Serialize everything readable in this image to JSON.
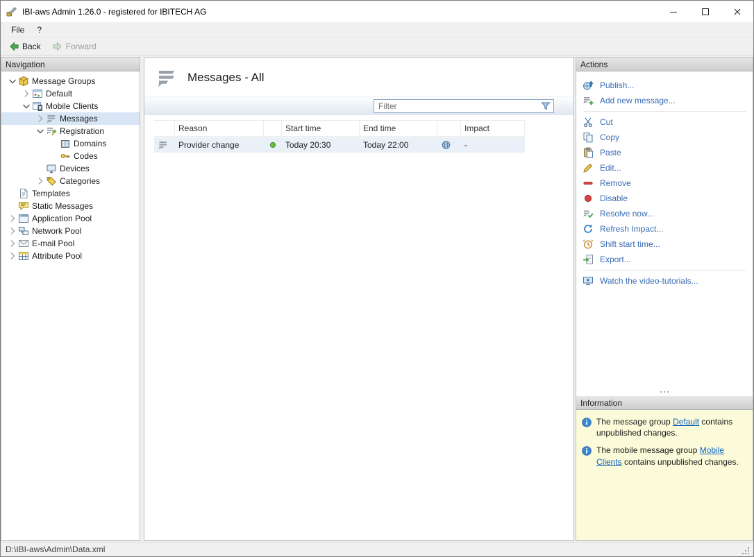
{
  "window": {
    "title": "IBI-aws Admin 1.26.0 - registered for IBITECH AG"
  },
  "menu": {
    "items": [
      "File",
      "?"
    ]
  },
  "toolbar": {
    "back": "Back",
    "forward": "Forward"
  },
  "navigation": {
    "header": "Navigation",
    "tree": [
      {
        "id": "message-groups",
        "label": "Message Groups",
        "level": 0,
        "icon": "message-groups",
        "expanded": true
      },
      {
        "id": "default",
        "label": "Default",
        "level": 1,
        "icon": "group-window",
        "collapsible": true
      },
      {
        "id": "mobile-clients",
        "label": "Mobile Clients",
        "level": 1,
        "icon": "mobile-window",
        "expanded": true
      },
      {
        "id": "messages",
        "label": "Messages",
        "level": 2,
        "icon": "messages",
        "collapsible": true,
        "selected": true
      },
      {
        "id": "registration",
        "label": "Registration",
        "level": 2,
        "icon": "registration",
        "expanded": true
      },
      {
        "id": "domains",
        "label": "Domains",
        "level": 3,
        "icon": "domains"
      },
      {
        "id": "codes",
        "label": "Codes",
        "level": 3,
        "icon": "codes"
      },
      {
        "id": "devices",
        "label": "Devices",
        "level": 2,
        "icon": "devices"
      },
      {
        "id": "categories",
        "label": "Categories",
        "level": 2,
        "icon": "categories",
        "collapsible": true
      },
      {
        "id": "templates",
        "label": "Templates",
        "level": 0,
        "icon": "templates"
      },
      {
        "id": "static-messages",
        "label": "Static Messages",
        "level": 0,
        "icon": "static-messages"
      },
      {
        "id": "application-pool",
        "label": "Application Pool",
        "level": 0,
        "icon": "application-pool",
        "collapsible": true
      },
      {
        "id": "network-pool",
        "label": "Network Pool",
        "level": 0,
        "icon": "network-pool",
        "collapsible": true
      },
      {
        "id": "e-mail-pool",
        "label": "E-mail Pool",
        "level": 0,
        "icon": "email-pool",
        "collapsible": true
      },
      {
        "id": "attribute-pool",
        "label": "Attribute Pool",
        "level": 0,
        "icon": "attribute-pool",
        "collapsible": true
      }
    ]
  },
  "main": {
    "title": "Messages - All",
    "filter": {
      "placeholder": "Filter"
    },
    "table": {
      "columns": [
        "",
        "Reason",
        "",
        "Start time",
        "End time",
        "",
        "Impact"
      ],
      "rows": [
        {
          "reason": "Provider change",
          "status": "active",
          "start": "Today 20:30",
          "end": "Today 22:00",
          "impact": "-"
        }
      ]
    }
  },
  "actions": {
    "header": "Actions",
    "items": [
      {
        "id": "publish",
        "label": "Publish...",
        "icon": "publish"
      },
      {
        "id": "add-new-message",
        "label": "Add new message...",
        "icon": "add-message",
        "divider_after": true
      },
      {
        "id": "cut",
        "label": "Cut",
        "icon": "cut"
      },
      {
        "id": "copy",
        "label": "Copy",
        "icon": "copy"
      },
      {
        "id": "paste",
        "label": "Paste",
        "icon": "paste"
      },
      {
        "id": "edit",
        "label": "Edit...",
        "icon": "edit"
      },
      {
        "id": "remove",
        "label": "Remove",
        "icon": "remove"
      },
      {
        "id": "disable",
        "label": "Disable",
        "icon": "disable"
      },
      {
        "id": "resolve-now",
        "label": "Resolve now...",
        "icon": "resolve"
      },
      {
        "id": "refresh-impact",
        "label": "Refresh Impact...",
        "icon": "refresh"
      },
      {
        "id": "shift-start-time",
        "label": "Shift start time...",
        "icon": "shift"
      },
      {
        "id": "export",
        "label": "Export...",
        "icon": "export",
        "divider_after": true
      },
      {
        "id": "watch-video-tutorials",
        "label": "Watch the video-tutorials...",
        "icon": "video"
      }
    ]
  },
  "information": {
    "header": "Information",
    "items": [
      {
        "prefix": "The message group ",
        "link": "Default",
        "link_id": "default",
        "suffix": " contains unpublished changes."
      },
      {
        "prefix": "The mobile message group ",
        "link": "Mobile Clients",
        "link_id": "mobile-clients",
        "suffix": " contains unpublished changes."
      }
    ]
  },
  "statusbar": {
    "path": "D:\\IBI-aws\\Admin\\Data.xml"
  }
}
